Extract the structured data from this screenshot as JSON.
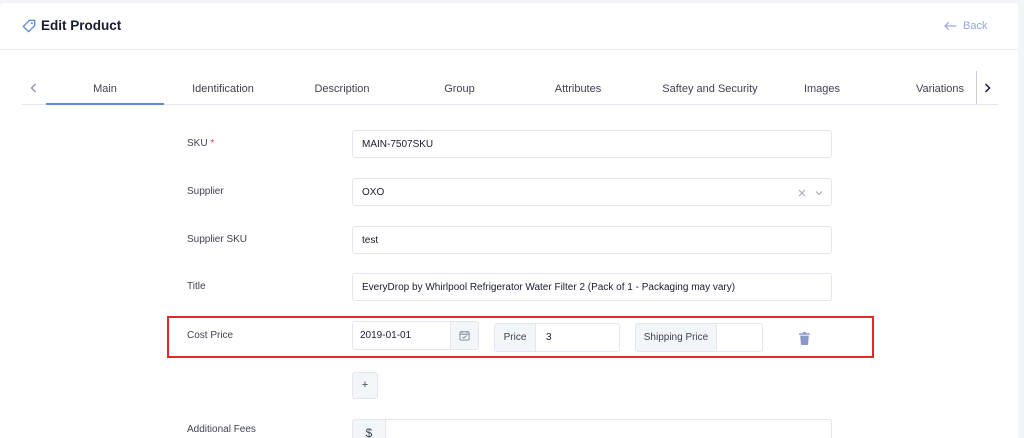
{
  "header": {
    "title": "Edit Product",
    "back_label": "Back"
  },
  "tabs": [
    {
      "label": "Main",
      "active": true
    },
    {
      "label": "Identification"
    },
    {
      "label": "Description"
    },
    {
      "label": "Group"
    },
    {
      "label": "Attributes"
    },
    {
      "label": "Saftey and Security"
    },
    {
      "label": "Images"
    },
    {
      "label": "Variations"
    }
  ],
  "form": {
    "sku": {
      "label": "SKU",
      "required_mark": "*",
      "value": "MAIN-7507SKU"
    },
    "supplier": {
      "label": "Supplier",
      "value": "OXO"
    },
    "supplier_sku": {
      "label": "Supplier SKU",
      "value": "test"
    },
    "title": {
      "label": "Title",
      "value": "EveryDrop by Whirlpool Refrigerator Water Filter 2 (Pack of 1 - Packaging may vary)"
    },
    "cost_price": {
      "label": "Cost Price",
      "date": "2019-01-01",
      "price_label": "Price",
      "price_value": "3",
      "shipping_label": "Shipping Price",
      "shipping_value": ""
    },
    "add_button_label": "+",
    "additional_fees": {
      "label": "Additional Fees",
      "currency": "$",
      "value": ""
    }
  },
  "colors": {
    "accent": "#5f8bd6",
    "highlight": "#e3272a",
    "trash": "#8b99c9",
    "back_link": "#9aa6d6"
  }
}
